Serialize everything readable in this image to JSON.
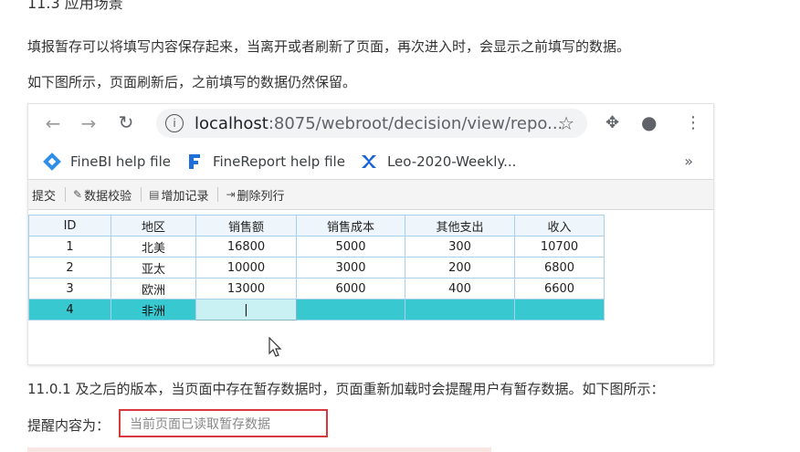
{
  "heading_partial": "11.3 应用场景",
  "paragraphs": {
    "p1": "填报暂存可以将填写内容保存起来，当离开或者刷新了页面，再次进入时，会显示之前填写的数据。",
    "p2": "如下图所示，页面刷新后，之前填写的数据仍然保留。",
    "p3": "11.0.1 及之后的版本，当页面中存在暂存数据时，页面重新加载时会提醒用户有暂存数据。如下图所示：",
    "tip_label": "提醒内容为：",
    "tip_text": "当前页面已读取暂存数据"
  },
  "browser": {
    "url_host": "localhost",
    "url_rest": ":8075/webroot/decision/view/repo...",
    "bookmarks": [
      "FineBI help file",
      "FineReport help file",
      "Leo-2020-Weekly..."
    ],
    "more": "»"
  },
  "report_toolbar": {
    "submit": "提交",
    "validate": "数据校验",
    "add_record": "增加记录",
    "delete_row": "删除列行"
  },
  "table": {
    "headers": [
      "ID",
      "地区",
      "销售额",
      "销售成本",
      "其他支出",
      "收入"
    ],
    "rows": [
      [
        "1",
        "北美",
        "16800",
        "5000",
        "300",
        "10700"
      ],
      [
        "2",
        "亚太",
        "10000",
        "3000",
        "200",
        "6800"
      ],
      [
        "3",
        "欧洲",
        "13000",
        "6000",
        "400",
        "6600"
      ],
      [
        "4",
        "非洲",
        "|",
        "",
        "",
        ""
      ]
    ]
  },
  "colors": {
    "selected_row": "#38c9d0",
    "grid_border": "#a9d0ea",
    "tip_border": "#d9383f"
  }
}
